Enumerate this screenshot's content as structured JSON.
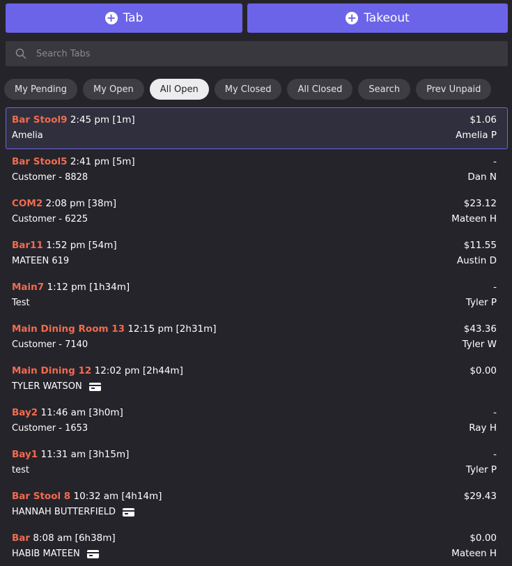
{
  "top_buttons": {
    "tab_label": "Tab",
    "takeout_label": "Takeout"
  },
  "search": {
    "placeholder": "Search Tabs",
    "value": ""
  },
  "filters": [
    {
      "label": "My Pending",
      "active": false
    },
    {
      "label": "My Open",
      "active": false
    },
    {
      "label": "All Open",
      "active": true
    },
    {
      "label": "My Closed",
      "active": false
    },
    {
      "label": "All Closed",
      "active": false
    },
    {
      "label": "Search",
      "active": false
    },
    {
      "label": "Prev Unpaid",
      "active": false
    }
  ],
  "tabs": [
    {
      "table": "Bar Stool9",
      "time": "2:45 pm [1m]",
      "customer": "Amelia",
      "amount": "$1.06",
      "server": "Amelia P",
      "card": false,
      "selected": true
    },
    {
      "table": "Bar Stool5",
      "time": "2:41 pm [5m]",
      "customer": "Customer - 8828",
      "amount": "-",
      "server": "Dan N",
      "card": false,
      "selected": false
    },
    {
      "table": "COM2",
      "time": "2:08 pm [38m]",
      "customer": "Customer - 6225",
      "amount": "$23.12",
      "server": "Mateen H",
      "card": false,
      "selected": false
    },
    {
      "table": "Bar11",
      "time": "1:52 pm [54m]",
      "customer": "MATEEN 619",
      "amount": "$11.55",
      "server": "Austin D",
      "card": false,
      "selected": false
    },
    {
      "table": "Main7",
      "time": "1:12 pm [1h34m]",
      "customer": "Test",
      "amount": "-",
      "server": "Tyler P",
      "card": false,
      "selected": false
    },
    {
      "table": "Main Dining Room 13",
      "time": "12:15 pm [2h31m]",
      "customer": "Customer - 7140",
      "amount": "$43.36",
      "server": "Tyler W",
      "card": false,
      "selected": false
    },
    {
      "table": "Main Dining 12",
      "time": "12:02 pm [2h44m]",
      "customer": "TYLER WATSON",
      "amount": "$0.00",
      "server": "",
      "card": true,
      "selected": false
    },
    {
      "table": "Bay2",
      "time": "11:46 am [3h0m]",
      "customer": "Customer - 1653",
      "amount": "-",
      "server": "Ray H",
      "card": false,
      "selected": false
    },
    {
      "table": "Bay1",
      "time": "11:31 am [3h15m]",
      "customer": "test",
      "amount": "-",
      "server": "Tyler P",
      "card": false,
      "selected": false
    },
    {
      "table": "Bar Stool 8",
      "time": "10:32 am [4h14m]",
      "customer": "HANNAH BUTTERFIELD",
      "amount": "$29.43",
      "server": "",
      "card": true,
      "selected": false
    },
    {
      "table": "Bar",
      "time": "8:08 am [6h38m]",
      "customer": "HABIB MATEEN",
      "amount": "$0.00",
      "server": "Mateen H",
      "card": true,
      "selected": false
    }
  ],
  "colors": {
    "accent": "#6b64e8",
    "table_name": "#f26b4e",
    "background": "#26242b",
    "chip": "#3e3d44",
    "chip_active": "#ececee"
  },
  "icons": {
    "plus": "plus-circle-icon",
    "search": "search-icon",
    "card": "credit-card-icon"
  }
}
